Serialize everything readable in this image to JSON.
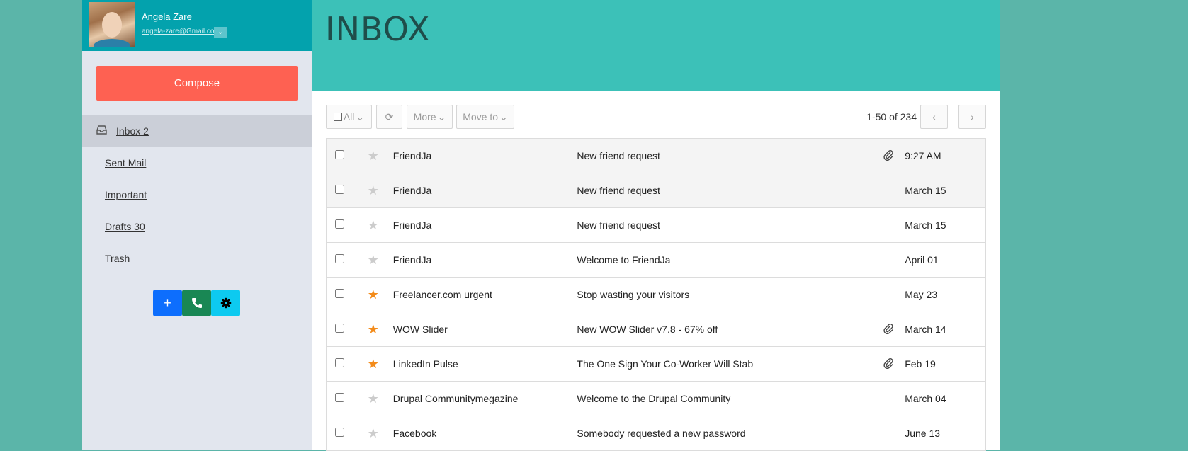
{
  "user": {
    "name": "Angela Zare",
    "email": "angela-zare@Gmail.com"
  },
  "compose_label": "Compose",
  "folders": [
    {
      "label": "Inbox 2",
      "active": true
    },
    {
      "label": "Sent Mail",
      "active": false
    },
    {
      "label": "Important",
      "active": false
    },
    {
      "label": "Drafts 30",
      "active": false
    },
    {
      "label": "Trash",
      "active": false
    }
  ],
  "page_title": "INBOX",
  "toolbar": {
    "select_all_label": "All",
    "more_label": "More",
    "move_to_label": "Move to",
    "pagination": "1-50 of 234"
  },
  "messages": [
    {
      "from": "FriendJa",
      "subject": "New friend request",
      "date": "9:27 AM",
      "starred": false,
      "attachment": true
    },
    {
      "from": "FriendJa",
      "subject": "New friend request",
      "date": "March 15",
      "starred": false,
      "attachment": false
    },
    {
      "from": "FriendJa",
      "subject": "New friend request",
      "date": "March 15",
      "starred": false,
      "attachment": false
    },
    {
      "from": "FriendJa",
      "subject": "Welcome to FriendJa",
      "date": "April 01",
      "starred": false,
      "attachment": false
    },
    {
      "from": "Freelancer.com urgent",
      "subject": "Stop wasting your visitors",
      "date": "May 23",
      "starred": true,
      "attachment": false
    },
    {
      "from": "WOW Slider",
      "subject": "New WOW Slider v7.8 - 67% off",
      "date": "March 14",
      "starred": true,
      "attachment": true
    },
    {
      "from": "LinkedIn Pulse",
      "subject": "The One Sign Your Co-Worker Will Stab",
      "date": "Feb 19",
      "starred": true,
      "attachment": true
    },
    {
      "from": "Drupal Communitymegazine",
      "subject": "Welcome to the Drupal Community",
      "date": "March 04",
      "starred": false,
      "attachment": false
    },
    {
      "from": "Facebook",
      "subject": "Somebody requested a new password",
      "date": "June 13",
      "starred": false,
      "attachment": false
    }
  ],
  "colors": {
    "background": "#5bb5a9",
    "profile_bar": "#03a2ad",
    "header": "#3cc1b8",
    "compose": "#fe6152",
    "star_on": "#f38b1a",
    "star_off": "#cccccc"
  },
  "icons": {
    "inbox": "inbox-tray-icon",
    "star": "star-icon",
    "attachment": "paperclip-icon",
    "refresh": "refresh-icon",
    "add": "plus-icon",
    "call": "phone-icon",
    "settings": "gear-icon"
  }
}
